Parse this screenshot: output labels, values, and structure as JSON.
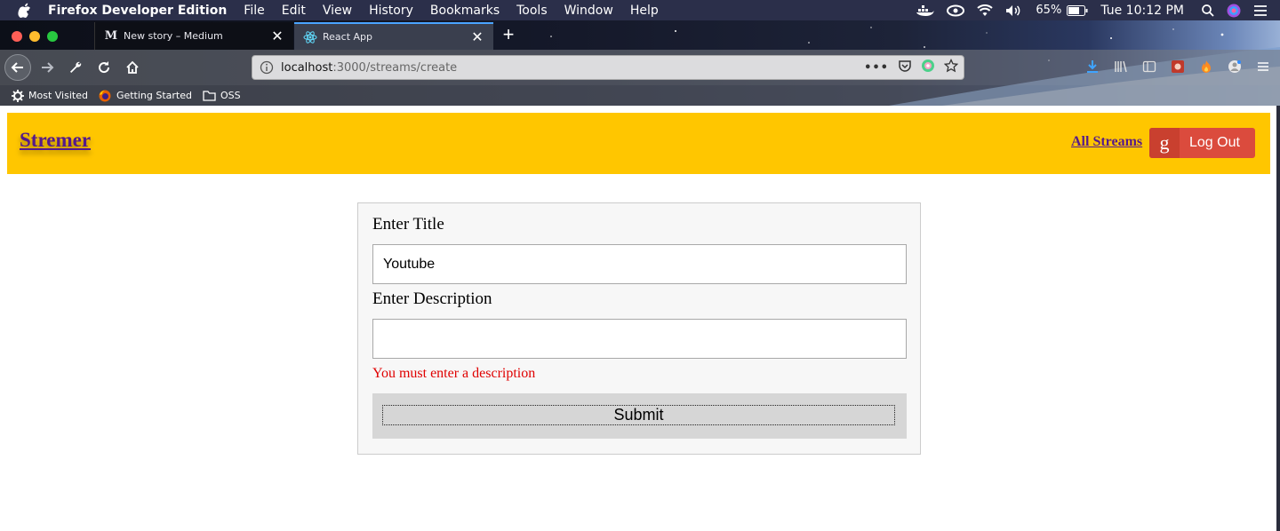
{
  "menubar": {
    "app_name": "Firefox Developer Edition",
    "items": [
      "File",
      "Edit",
      "View",
      "History",
      "Bookmarks",
      "Tools",
      "Window",
      "Help"
    ],
    "battery": "65%",
    "clock": "Tue 10:12 PM"
  },
  "tabs": [
    {
      "title": "New story – Medium",
      "favicon_text": "M"
    },
    {
      "title": "React App"
    }
  ],
  "urlbar": {
    "host": "localhost",
    "path": ":3000/streams/create"
  },
  "bookmarks": [
    {
      "label": "Most Visited",
      "icon": "gear-icon"
    },
    {
      "label": "Getting Started",
      "icon": "firefox-icon"
    },
    {
      "label": "OSS",
      "icon": "folder-icon"
    }
  ],
  "header": {
    "brand": "Stremer",
    "all_streams": "All Streams",
    "logout": "Log Out",
    "logout_icon_text": "g",
    "bg_color": "#ffc600",
    "logout_color": "#db4b3d",
    "link_color": "#551a8b"
  },
  "form": {
    "title_label": "Enter Title",
    "title_value": "Youtube",
    "description_label": "Enter Description",
    "description_value": "",
    "error": "You must enter a description",
    "error_color": "#e00000",
    "submit": "Submit"
  }
}
